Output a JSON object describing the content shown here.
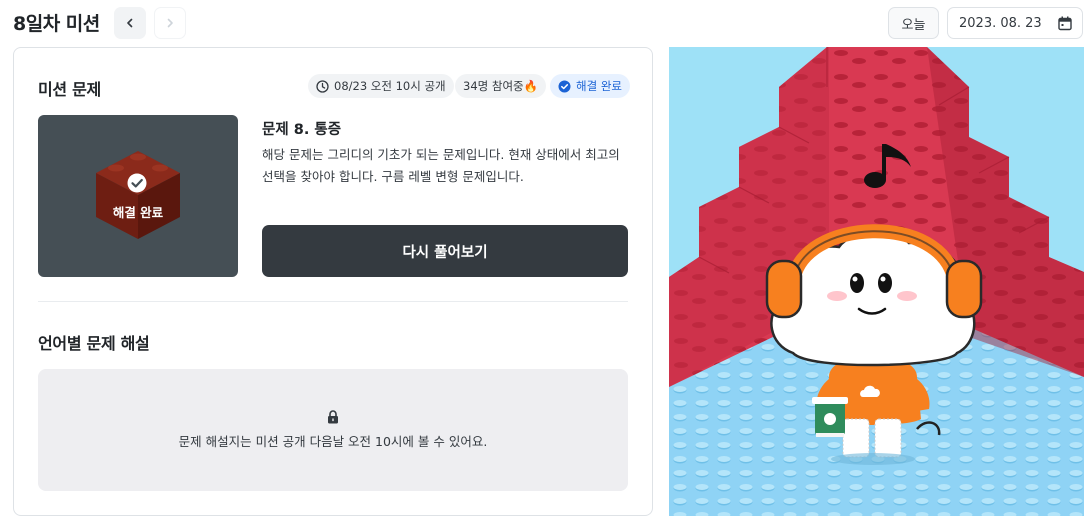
{
  "header": {
    "title": "8일차 미션",
    "today_label": "오늘",
    "date_value": "2023. 08. 23"
  },
  "mission": {
    "section_title": "미션 문제",
    "chips": {
      "open_time": "08/23 오전 10시 공개",
      "participants": "34명 참여중🔥",
      "status": "해결 완료"
    },
    "thumbnail_label": "해결 완료",
    "problem_title": "문제 8. 통증",
    "problem_description": "해당 문제는 그리디의 기초가 되는 문제입니다. 현재 상태에서 최고의 선택을 찾아야 합니다. 구름 레벨 변형 문제입니다.",
    "retry_button": "다시 풀어보기"
  },
  "solutions": {
    "section_title": "언어별 문제 해설",
    "locked_message": "문제 해설지는 미션 공개 다음날 오전 10시에 볼 수 있어요."
  },
  "colors": {
    "accent": "#1c63d5",
    "dark_button": "#343a40",
    "lego_red": "#d93952",
    "lego_floor": "#8fd3f5",
    "sky": "#9ee1f7",
    "mascot_orange": "#f7801f"
  },
  "icons": {
    "prev": "chevron-left-icon",
    "next": "chevron-right-icon",
    "calendar": "calendar-icon",
    "clock": "clock-icon",
    "check": "check-circle-icon",
    "lock": "lock-icon"
  }
}
